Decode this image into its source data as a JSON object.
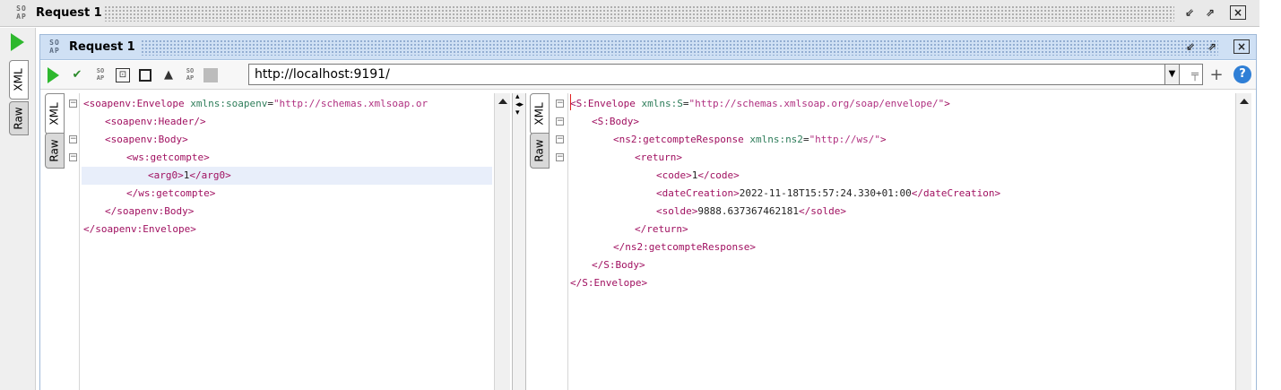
{
  "outer_window": {
    "title": "Request 1",
    "logo_text": "SO AP"
  },
  "outer_tabs": {
    "xml": "XML",
    "raw": "Raw"
  },
  "inner_window": {
    "title": "Request 1",
    "logo_text": "SO AP"
  },
  "toolbar": {
    "url": "http://localhost:9191/",
    "help": "?"
  },
  "request_tabs": {
    "xml": "XML",
    "raw": "Raw"
  },
  "response_tabs": {
    "xml": "XML",
    "raw": "Raw"
  },
  "request_xml": [
    {
      "indent": 0,
      "fold": true,
      "parts": [
        [
          "br",
          "<"
        ],
        [
          "tag",
          "soapenv:Envelope"
        ],
        [
          "txt",
          " "
        ],
        [
          "attr",
          "xmlns:soapenv"
        ],
        [
          "eq",
          "="
        ],
        [
          "val",
          "\"http://schemas.xmlsoap.or"
        ]
      ]
    },
    {
      "indent": 1,
      "fold": false,
      "parts": [
        [
          "br",
          "<"
        ],
        [
          "tag",
          "soapenv:Header"
        ],
        [
          "br",
          "/>"
        ]
      ]
    },
    {
      "indent": 1,
      "fold": true,
      "parts": [
        [
          "br",
          "<"
        ],
        [
          "tag",
          "soapenv:Body"
        ],
        [
          "br",
          ">"
        ]
      ]
    },
    {
      "indent": 2,
      "fold": true,
      "parts": [
        [
          "br",
          "<"
        ],
        [
          "tag",
          "ws:getcompte"
        ],
        [
          "br",
          ">"
        ]
      ]
    },
    {
      "indent": 3,
      "fold": false,
      "highlight": true,
      "parts": [
        [
          "br",
          "<"
        ],
        [
          "tag",
          "arg0"
        ],
        [
          "br",
          ">"
        ],
        [
          "txt",
          "1"
        ],
        [
          "br",
          "</"
        ],
        [
          "tag",
          "arg0"
        ],
        [
          "br",
          ">"
        ]
      ]
    },
    {
      "indent": 2,
      "fold": false,
      "parts": [
        [
          "br",
          "</"
        ],
        [
          "tag",
          "ws:getcompte"
        ],
        [
          "br",
          ">"
        ]
      ]
    },
    {
      "indent": 1,
      "fold": false,
      "parts": [
        [
          "br",
          "</"
        ],
        [
          "tag",
          "soapenv:Body"
        ],
        [
          "br",
          ">"
        ]
      ]
    },
    {
      "indent": 0,
      "fold": false,
      "parts": [
        [
          "br",
          "</"
        ],
        [
          "tag",
          "soapenv:Envelope"
        ],
        [
          "br",
          ">"
        ]
      ]
    }
  ],
  "response_xml": [
    {
      "indent": 0,
      "fold": true,
      "parts": [
        [
          "br",
          "<"
        ],
        [
          "tag",
          "S:Envelope"
        ],
        [
          "txt",
          " "
        ],
        [
          "attr",
          "xmlns:S"
        ],
        [
          "eq",
          "="
        ],
        [
          "val",
          "\"http://schemas.xmlsoap.org/soap/envelope/\""
        ],
        [
          "br",
          ">"
        ]
      ]
    },
    {
      "indent": 1,
      "fold": true,
      "parts": [
        [
          "br",
          "<"
        ],
        [
          "tag",
          "S:Body"
        ],
        [
          "br",
          ">"
        ]
      ]
    },
    {
      "indent": 2,
      "fold": true,
      "parts": [
        [
          "br",
          "<"
        ],
        [
          "tag",
          "ns2:getcompteResponse"
        ],
        [
          "txt",
          " "
        ],
        [
          "attr",
          "xmlns:ns2"
        ],
        [
          "eq",
          "="
        ],
        [
          "val",
          "\"http://ws/\""
        ],
        [
          "br",
          ">"
        ]
      ]
    },
    {
      "indent": 3,
      "fold": true,
      "parts": [
        [
          "br",
          "<"
        ],
        [
          "tag",
          "return"
        ],
        [
          "br",
          ">"
        ]
      ]
    },
    {
      "indent": 4,
      "fold": false,
      "parts": [
        [
          "br",
          "<"
        ],
        [
          "tag",
          "code"
        ],
        [
          "br",
          ">"
        ],
        [
          "txt",
          "1"
        ],
        [
          "br",
          "</"
        ],
        [
          "tag",
          "code"
        ],
        [
          "br",
          ">"
        ]
      ]
    },
    {
      "indent": 4,
      "fold": false,
      "parts": [
        [
          "br",
          "<"
        ],
        [
          "tag",
          "dateCreation"
        ],
        [
          "br",
          ">"
        ],
        [
          "txt",
          "2022-11-18T15:57:24.330+01:00"
        ],
        [
          "br",
          "</"
        ],
        [
          "tag",
          "dateCreation"
        ],
        [
          "br",
          ">"
        ]
      ]
    },
    {
      "indent": 4,
      "fold": false,
      "parts": [
        [
          "br",
          "<"
        ],
        [
          "tag",
          "solde"
        ],
        [
          "br",
          ">"
        ],
        [
          "txt",
          "9888.637367462181"
        ],
        [
          "br",
          "</"
        ],
        [
          "tag",
          "solde"
        ],
        [
          "br",
          ">"
        ]
      ]
    },
    {
      "indent": 3,
      "fold": false,
      "parts": [
        [
          "br",
          "</"
        ],
        [
          "tag",
          "return"
        ],
        [
          "br",
          ">"
        ]
      ]
    },
    {
      "indent": 2,
      "fold": false,
      "parts": [
        [
          "br",
          "</"
        ],
        [
          "tag",
          "ns2:getcompteResponse"
        ],
        [
          "br",
          ">"
        ]
      ]
    },
    {
      "indent": 1,
      "fold": false,
      "parts": [
        [
          "br",
          "</"
        ],
        [
          "tag",
          "S:Body"
        ],
        [
          "br",
          ">"
        ]
      ]
    },
    {
      "indent": 0,
      "fold": false,
      "parts": [
        [
          "br",
          "</"
        ],
        [
          "tag",
          "S:Envelope"
        ],
        [
          "br",
          ">"
        ]
      ]
    }
  ],
  "colors": {
    "tag": "#a01060",
    "attribute": "#2e7d5a",
    "value": "#b03080",
    "run": "#2eb82e",
    "inner_title_bg": "#cfe0f4",
    "help": "#2f7fd6"
  }
}
